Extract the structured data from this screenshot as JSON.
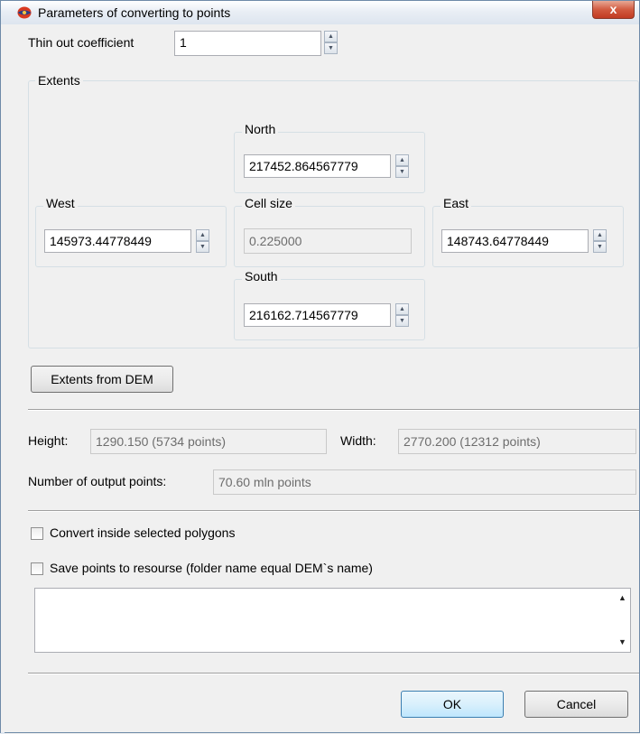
{
  "window": {
    "title": "Parameters of converting to points",
    "close_symbol": "x"
  },
  "thin_out": {
    "label": "Thin out coefficient",
    "value": "1"
  },
  "extents": {
    "label": "Extents",
    "north": {
      "label": "North",
      "value": "217452.864567779"
    },
    "west": {
      "label": "West",
      "value": "145973.44778449"
    },
    "cell_size": {
      "label": "Cell size",
      "value": "0.225000"
    },
    "east": {
      "label": "East",
      "value": "148743.64778449"
    },
    "south": {
      "label": "South",
      "value": "216162.714567779"
    }
  },
  "extents_from_dem_label": "Extents from DEM",
  "height": {
    "label": "Height:",
    "value": "1290.150 (5734 points)"
  },
  "width": {
    "label": "Width:",
    "value": "2770.200 (12312 points)"
  },
  "output_points": {
    "label": "Number of output points:",
    "value": "70.60 mln points"
  },
  "checkboxes": {
    "inside_polygons": {
      "label": "Convert inside selected polygons",
      "checked": false
    },
    "save_points": {
      "label": "Save points to resourse (folder name equal DEM`s name)",
      "checked": false
    }
  },
  "notes": {
    "value": ""
  },
  "buttons": {
    "ok": "OK",
    "cancel": "Cancel"
  },
  "icons": {
    "app": "app-logo-icon",
    "spin_up": "▲",
    "spin_down": "▼",
    "scroll_up": "▲",
    "scroll_down": "▼"
  }
}
